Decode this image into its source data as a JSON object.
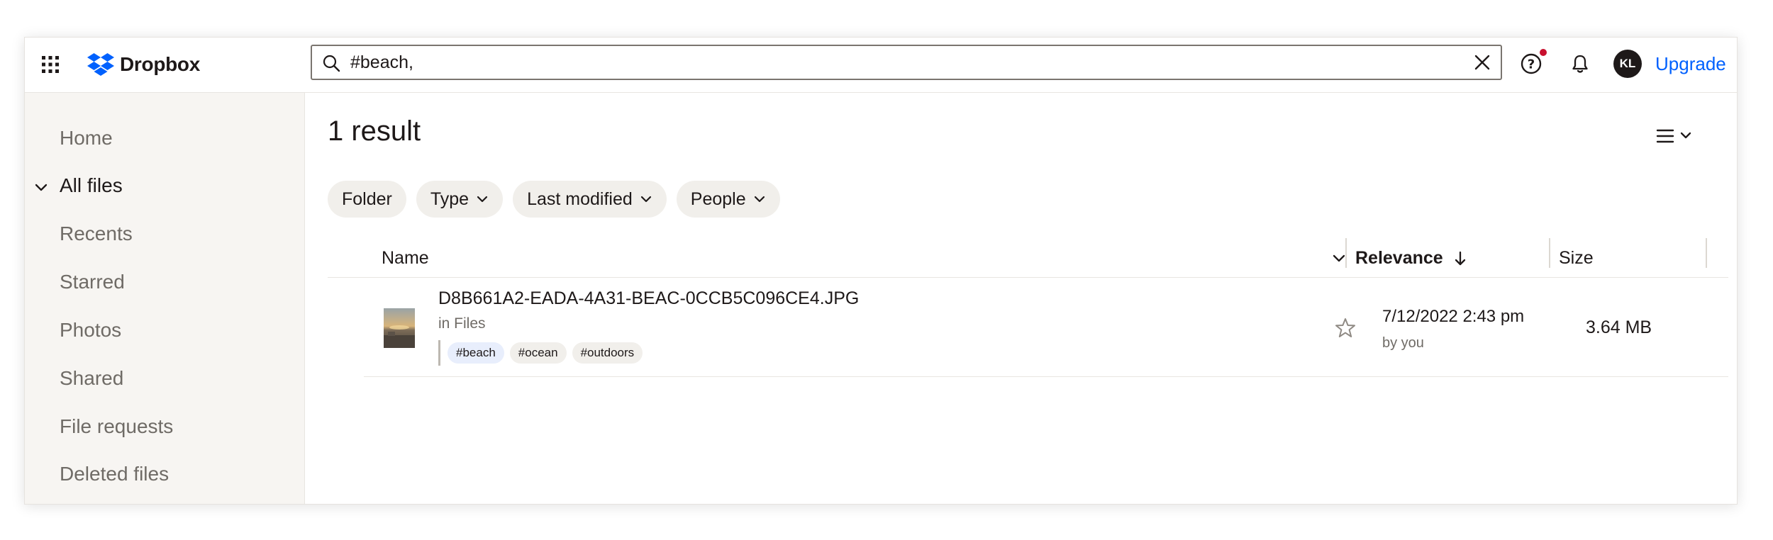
{
  "app": {
    "brand": "Dropbox"
  },
  "search": {
    "value": "#beach,"
  },
  "header": {
    "avatar_initials": "KL",
    "upgrade_label": "Upgrade"
  },
  "sidebar": {
    "items": [
      {
        "label": "Home"
      },
      {
        "label": "All files",
        "active": true,
        "expanded": true
      },
      {
        "label": "Recents"
      },
      {
        "label": "Starred"
      },
      {
        "label": "Photos"
      },
      {
        "label": "Shared"
      },
      {
        "label": "File requests"
      },
      {
        "label": "Deleted files"
      }
    ]
  },
  "main": {
    "result_count": "1 result",
    "filters": [
      {
        "label": "Folder",
        "dropdown": false
      },
      {
        "label": "Type",
        "dropdown": true
      },
      {
        "label": "Last modified",
        "dropdown": true
      },
      {
        "label": "People",
        "dropdown": true
      }
    ],
    "columns": {
      "name": "Name",
      "relevance": "Relevance",
      "size": "Size"
    },
    "rows": [
      {
        "name": "D8B661A2-EADA-4A31-BEAC-0CCB5C096CE4.JPG",
        "location": "in Files",
        "tags": [
          "#beach",
          "#ocean",
          "#outdoors"
        ],
        "modified": "7/12/2022 2:43 pm",
        "modified_by": "by you",
        "size": "3.64 MB",
        "starred": false
      }
    ]
  },
  "colors": {
    "brand_blue": "#0061fe",
    "notification_dot": "#c8102e",
    "sidebar_bg": "#f7f5f2",
    "chip_bg": "#f1efeb",
    "tag_highlight_bg": "#e8eefc"
  },
  "icons": [
    "apps-grid-icon",
    "dropbox-logo-icon",
    "search-icon",
    "close-icon",
    "help-icon",
    "bell-icon",
    "list-view-icon",
    "chevron-down-icon",
    "arrow-down-icon",
    "star-icon"
  ]
}
